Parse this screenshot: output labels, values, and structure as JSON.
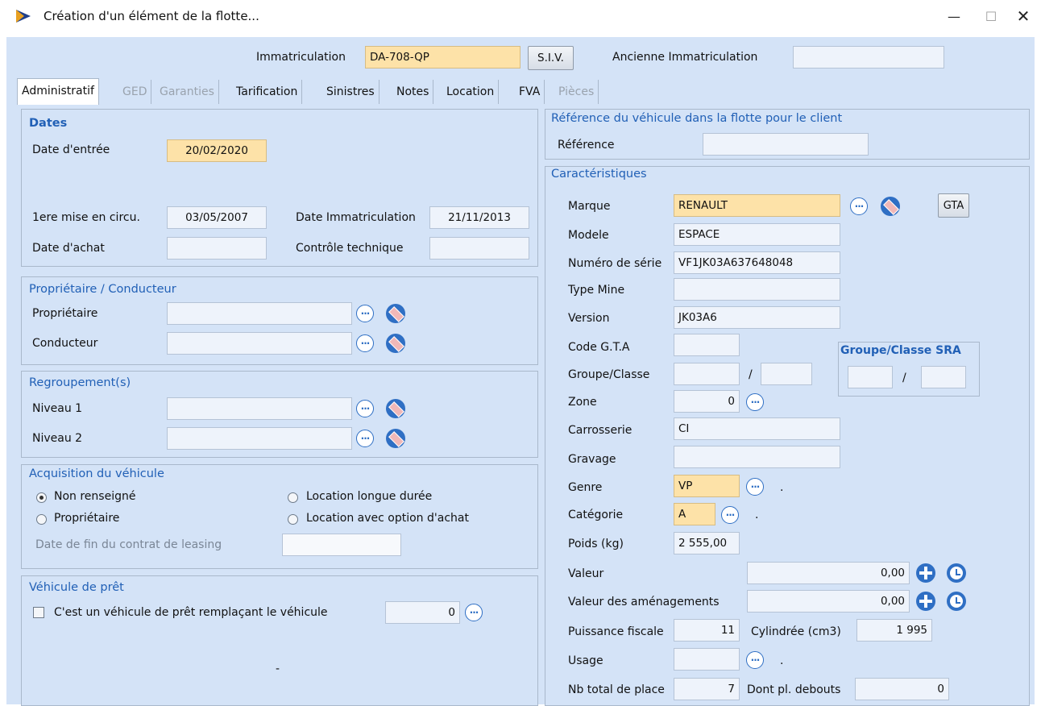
{
  "window": {
    "title": "Création d'un élément de la flotte...",
    "minimize": "—",
    "maximize": "☐",
    "close": "✕"
  },
  "header": {
    "immat_label": "Immatriculation",
    "immat_value": "DA-708-QP",
    "siv_button": "S.I.V.",
    "ancienne_label": "Ancienne Immatriculation",
    "ancienne_value": ""
  },
  "tabs": [
    {
      "label": "Administratif"
    },
    {
      "label": "GED"
    },
    {
      "label": "Garanties"
    },
    {
      "label": "Tarification"
    },
    {
      "label": "Sinistres"
    },
    {
      "label": "Notes"
    },
    {
      "label": "Location"
    },
    {
      "label": "FVA"
    },
    {
      "label": "Pièces"
    }
  ],
  "dates": {
    "title": "Dates",
    "entree_label": "Date d'entrée",
    "entree_value": "20/02/2020",
    "mise_label": "1ere mise en circu.",
    "mise_value": "03/05/2007",
    "immat_label": "Date Immatriculation",
    "immat_value": "21/11/2013",
    "achat_label": "Date d'achat",
    "achat_value": "",
    "controle_label": "Contrôle technique",
    "controle_value": ""
  },
  "proprietaire": {
    "title": "Propriétaire / Conducteur",
    "prop_label": "Propriétaire",
    "prop_value": "",
    "cond_label": "Conducteur",
    "cond_value": ""
  },
  "regroupement": {
    "title": "Regroupement(s)",
    "n1_label": "Niveau 1",
    "n1_value": "",
    "n2_label": "Niveau 2",
    "n2_value": ""
  },
  "acquisition": {
    "title": "Acquisition du véhicule",
    "opt1": "Non renseigné",
    "opt2": "Propriétaire",
    "opt3": "Location longue durée",
    "opt4": "Location avec option d'achat",
    "leasing_label": "Date de fin du contrat de leasing",
    "leasing_value": "",
    "selected": "Non renseigné"
  },
  "pret": {
    "title": "Véhicule de prêt",
    "check_label": "C'est un véhicule de prêt remplaçant le véhicule",
    "value": "0",
    "dash": "-"
  },
  "reference": {
    "title": "Référence du véhicule dans la flotte pour le client",
    "label": "Référence",
    "value": ""
  },
  "caracteristiques": {
    "title": "Caractéristiques",
    "marque_label": "Marque",
    "marque_value": "RENAULT",
    "gta_button": "GTA",
    "modele_label": "Modele",
    "modele_value": "ESPACE",
    "serie_label": "Numéro de série",
    "serie_value": "VF1JK03A637648048",
    "mine_label": "Type Mine",
    "mine_value": "",
    "version_label": "Version",
    "version_value": "JK03A6",
    "codegta_label": "Code G.T.A",
    "codegta_value": "",
    "groupe_label": "Groupe/Classe",
    "groupe_value": "",
    "classe_value": "",
    "slash": "/",
    "sra_title": "Groupe/Classe SRA",
    "sra_groupe": "",
    "sra_classe": "",
    "zone_label": "Zone",
    "zone_value": "0",
    "carrosserie_label": "Carrosserie",
    "carrosserie_value": "CI",
    "gravage_label": "Gravage",
    "gravage_value": "",
    "genre_label": "Genre",
    "genre_value": "VP",
    "genre_dot": ".",
    "categorie_label": "Catégorie",
    "categorie_value": "A",
    "categorie_dot": ".",
    "poids_label": "Poids (kg)",
    "poids_value": "2 555,00",
    "valeur_label": "Valeur",
    "valeur_value": "0,00",
    "amenag_label": "Valeur des aménagements",
    "amenag_value": "0,00",
    "puissance_label": "Puissance fiscale",
    "puissance_value": "11",
    "cylindree_label": "Cylindrée (cm3)",
    "cylindree_value": "1 995",
    "usage_label": "Usage",
    "usage_value": "",
    "usage_dot": ".",
    "places_label": "Nb total de place",
    "places_value": "7",
    "debout_label": "Dont pl. debouts",
    "debout_value": "0"
  }
}
